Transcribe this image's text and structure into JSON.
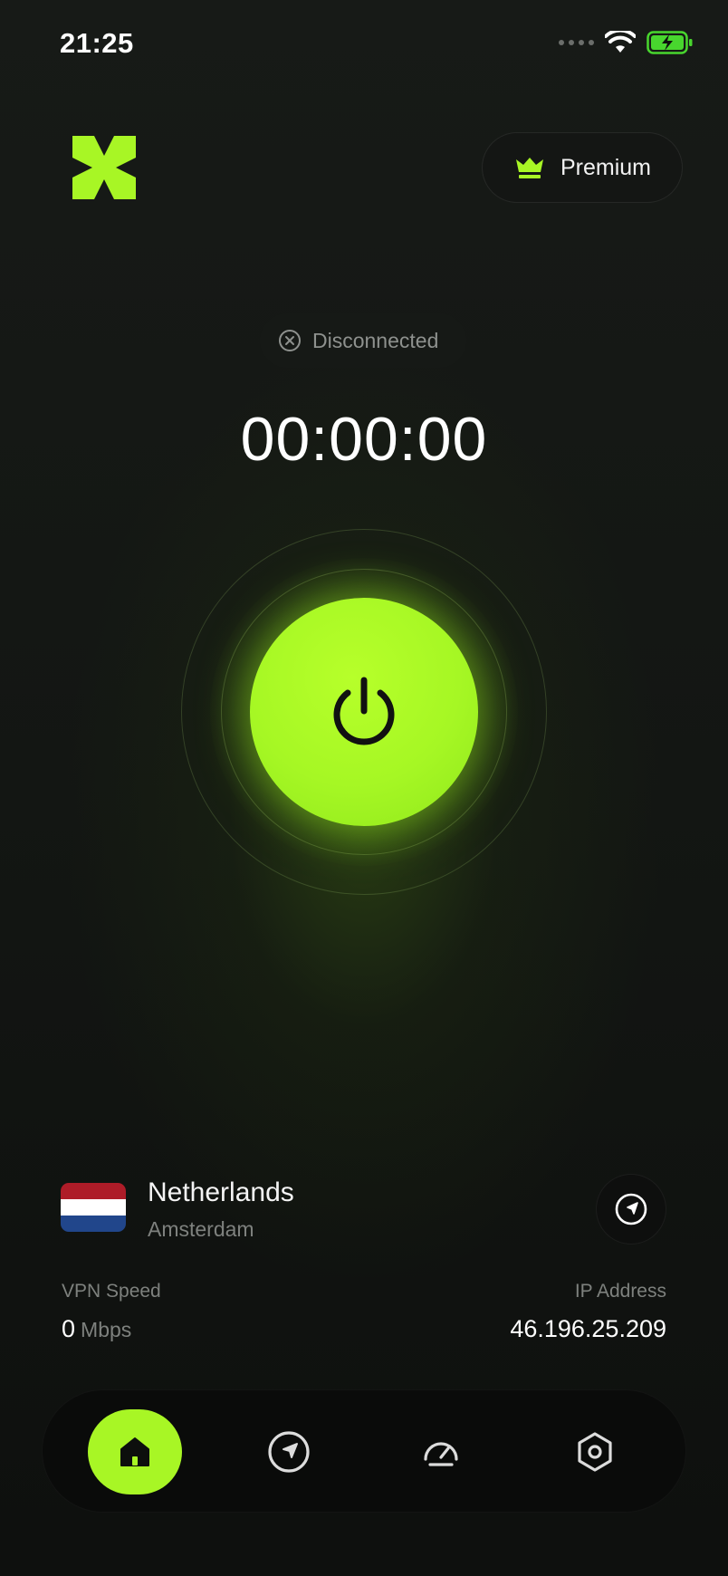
{
  "status_bar": {
    "time": "21:25",
    "icons": [
      "signal-dots-icon",
      "wifi-icon",
      "battery-charging-icon"
    ]
  },
  "header": {
    "logo": "x-logo-icon",
    "premium_label": "Premium",
    "premium_icon": "crown-icon"
  },
  "connection": {
    "status": "Disconnected",
    "status_icon": "x-circle-icon",
    "timer": "00:00:00",
    "power_icon": "power-icon"
  },
  "location": {
    "country": "Netherlands",
    "city": "Amsterdam",
    "flag_colors": [
      "#ae1c28",
      "#ffffff",
      "#21468b"
    ],
    "locate_icon": "navigation-arrow-icon"
  },
  "stats": {
    "speed_label": "VPN Speed",
    "speed_value": "0",
    "speed_unit": "Mbps",
    "ip_label": "IP Address",
    "ip_value": "46.196.25.209"
  },
  "nav": {
    "items": [
      {
        "icon": "home-icon",
        "active": true
      },
      {
        "icon": "navigation-icon",
        "active": false
      },
      {
        "icon": "speedometer-icon",
        "active": false
      },
      {
        "icon": "settings-hexagon-icon",
        "active": false
      }
    ]
  },
  "colors": {
    "accent": "#a8f625",
    "background": "#131613",
    "muted_text": "#7e817e"
  }
}
